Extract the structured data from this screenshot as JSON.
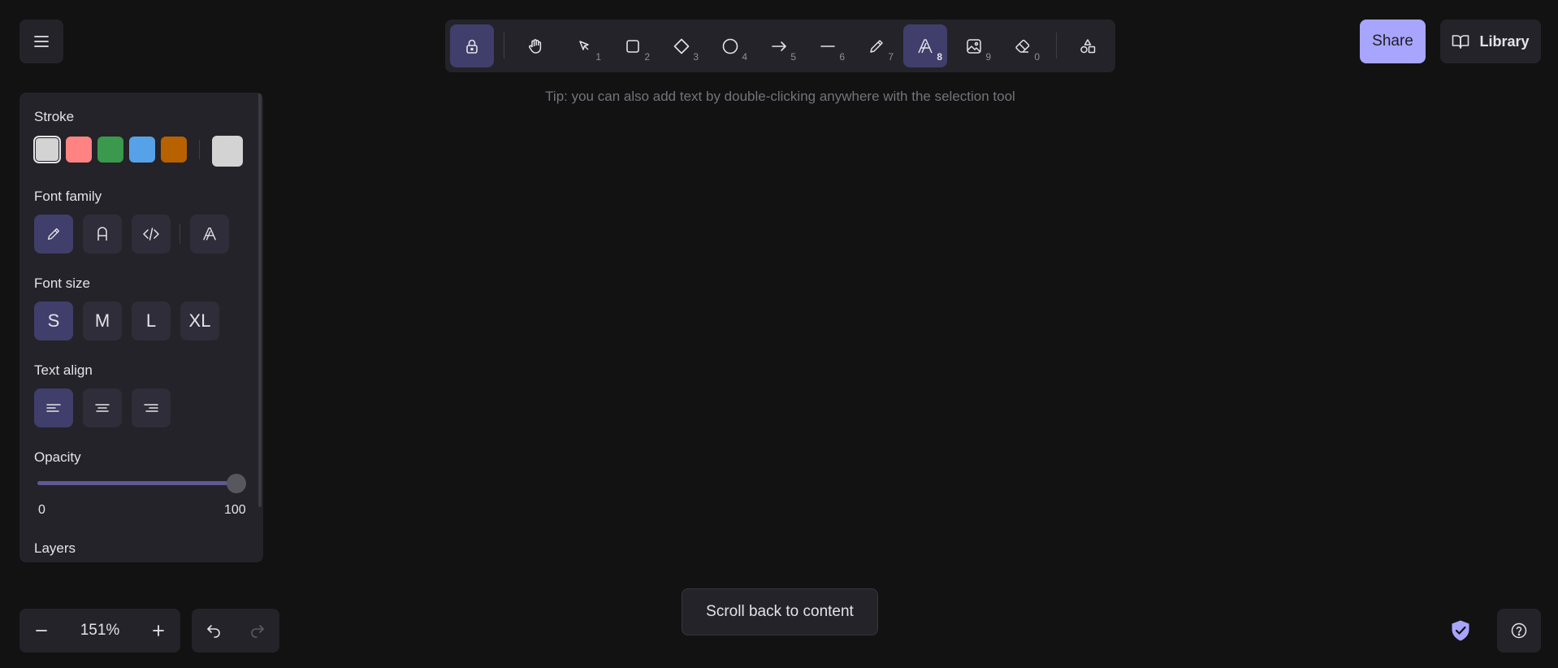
{
  "toolbar": {
    "tools": [
      {
        "name": "lock",
        "num": "",
        "active": true
      },
      {
        "name": "hand",
        "num": ""
      },
      {
        "name": "selection",
        "num": "1"
      },
      {
        "name": "rectangle",
        "num": "2"
      },
      {
        "name": "diamond",
        "num": "3"
      },
      {
        "name": "ellipse",
        "num": "4"
      },
      {
        "name": "arrow",
        "num": "5"
      },
      {
        "name": "line",
        "num": "6"
      },
      {
        "name": "draw",
        "num": "7"
      },
      {
        "name": "text",
        "num": "8",
        "active": true
      },
      {
        "name": "image",
        "num": "9"
      },
      {
        "name": "eraser",
        "num": "0"
      },
      {
        "name": "more-shapes",
        "num": ""
      }
    ]
  },
  "tip": "Tip: you can also add text by double-clicking anywhere with the selection tool",
  "header": {
    "share_label": "Share",
    "library_label": "Library"
  },
  "panel": {
    "stroke_title": "Stroke",
    "stroke_colors": [
      "#d3d3d3",
      "#ff8383",
      "#3a994c",
      "#56a2e8",
      "#b76100"
    ],
    "stroke_current": "#d3d3d3",
    "font_family_title": "Font family",
    "font_size_title": "Font size",
    "font_sizes": [
      "S",
      "M",
      "L",
      "XL"
    ],
    "text_align_title": "Text align",
    "opacity_title": "Opacity",
    "opacity_min": "0",
    "opacity_max": "100",
    "opacity_value": 100,
    "layers_title": "Layers"
  },
  "footer": {
    "zoom_level": "151%",
    "scroll_back": "Scroll back to content"
  }
}
